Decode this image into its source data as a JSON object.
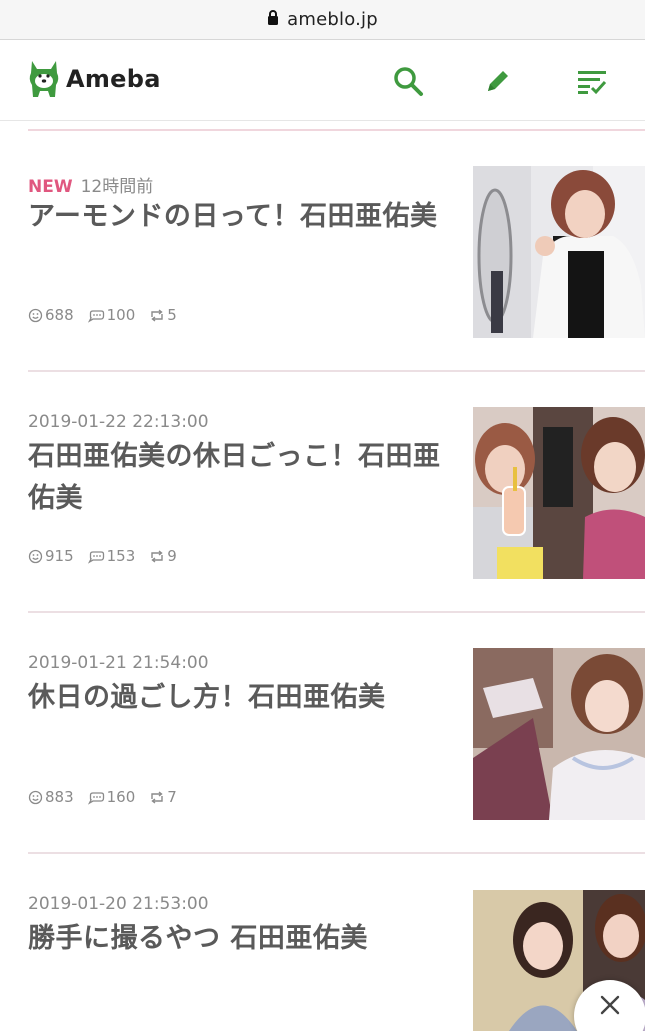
{
  "browser": {
    "url": "ameblo.jp"
  },
  "header": {
    "logo_text": "Ameba",
    "brand_color": "#3f9a3f"
  },
  "entries": [
    {
      "new_badge": "NEW",
      "date": "12時間前",
      "title": "アーモンドの日って！石田亜佑美",
      "likes": "688",
      "comments": "100",
      "reblogs": "5"
    },
    {
      "new_badge": "",
      "date": "2019-01-22 22:13:00",
      "title": "石田亜佑美の休日ごっこ！石田亜佑美",
      "likes": "915",
      "comments": "153",
      "reblogs": "9"
    },
    {
      "new_badge": "",
      "date": "2019-01-21 21:54:00",
      "title": "休日の過ごし方！石田亜佑美",
      "likes": "883",
      "comments": "160",
      "reblogs": "7"
    },
    {
      "new_badge": "",
      "date": "2019-01-20 21:53:00",
      "title": "勝手に撮るやつ 石田亜佑美",
      "likes": "",
      "comments": "",
      "reblogs": ""
    }
  ],
  "colors": {
    "accent_pink": "#e0577f",
    "icon_green": "#3f9a3f"
  }
}
